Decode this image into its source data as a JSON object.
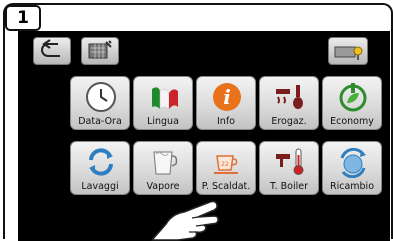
{
  "step_number": "1",
  "top_bar": {
    "back": "back-icon",
    "calendar": "calendar-settings-icon",
    "tools": "tools-icon"
  },
  "tiles_row1": [
    {
      "label": "Data-Ora",
      "icon": "clock-icon"
    },
    {
      "label": "Lingua",
      "icon": "italian-flag-icon"
    },
    {
      "label": "Info",
      "icon": "info-icon"
    },
    {
      "label": "Erogaz.",
      "icon": "dispensing-icon"
    },
    {
      "label": "Economy",
      "icon": "power-leaf-icon"
    }
  ],
  "tiles_row2": [
    {
      "label": "Lavaggi",
      "icon": "rinse-cycle-icon"
    },
    {
      "label": "Vapore",
      "icon": "steam-jug-icon"
    },
    {
      "label": "P. Scaldat.",
      "icon": "cup-warmer-icon"
    },
    {
      "label": "T. Boiler",
      "icon": "thermometer-icon"
    },
    {
      "label": "Ricambio",
      "icon": "water-change-icon"
    }
  ],
  "colors": {
    "screen_bg": "#000000",
    "info_orange": "#e8731c",
    "green": "#2e8b2e",
    "blue": "#2e7fc2",
    "dark_red": "#7a1d1d"
  }
}
